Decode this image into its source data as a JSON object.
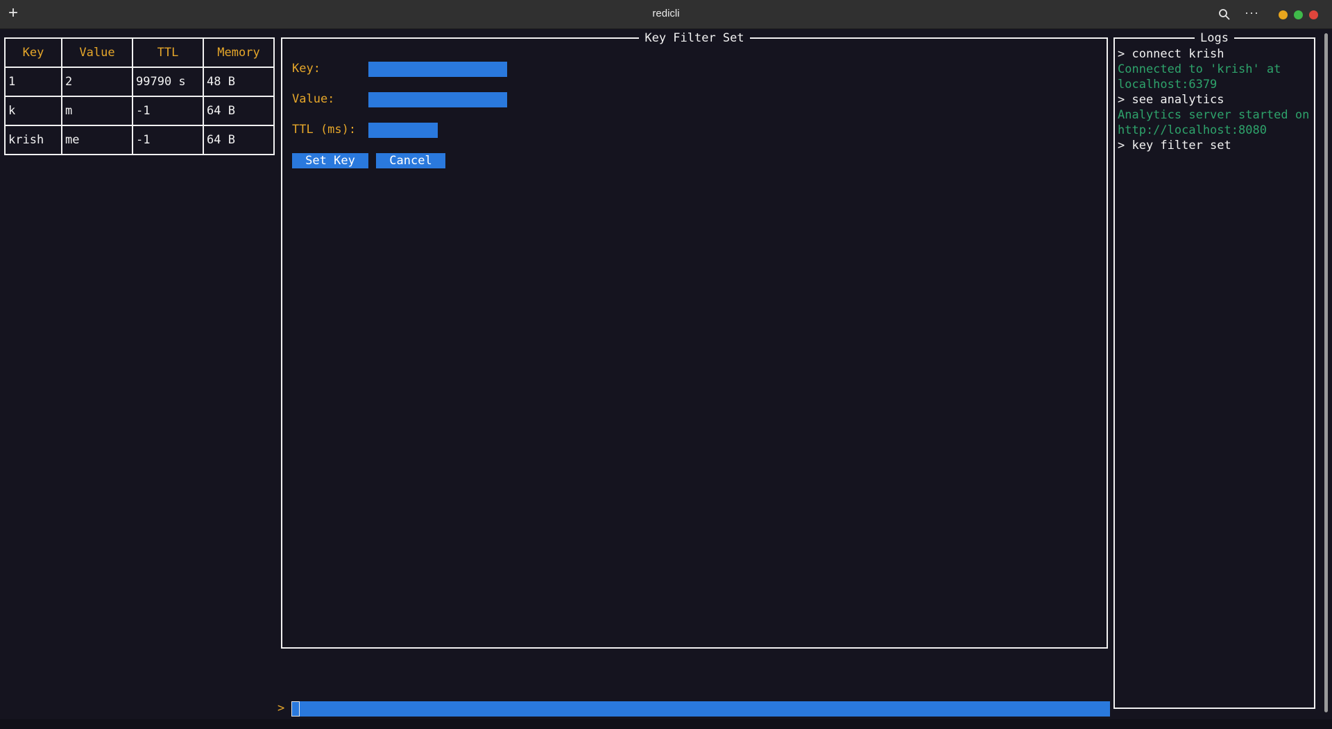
{
  "window": {
    "title": "redicli",
    "icons": {
      "new_tab": "plus-icon",
      "search": "search-icon",
      "menu": "ellipsis-icon"
    }
  },
  "table": {
    "headers": [
      "Key",
      "Value",
      "TTL",
      "Memory"
    ],
    "rows": [
      [
        "1",
        "2",
        "99790 s",
        "48 B"
      ],
      [
        "k",
        "m",
        "-1",
        "64 B"
      ],
      [
        "krish",
        "me",
        "-1",
        "64 B"
      ]
    ]
  },
  "form": {
    "title": "Key Filter Set",
    "key_label": "Key:",
    "key_value": "",
    "value_label": "Value:",
    "value_value": "",
    "ttl_label": "TTL (ms):",
    "ttl_value": "",
    "set_button": "Set Key",
    "cancel_button": "Cancel"
  },
  "logs": {
    "title": "Logs",
    "entries": [
      "> connect krish",
      "Connected to 'krish' at localhost:6379",
      "> see analytics",
      "Analytics server started on http://localhost:8080",
      "> key filter set"
    ]
  },
  "command": {
    "prompt": ">",
    "value": ""
  },
  "colors": {
    "background": "#15141f",
    "accent": "#2a79dd",
    "label": "#e6a72a",
    "success": "#2ea36b"
  }
}
